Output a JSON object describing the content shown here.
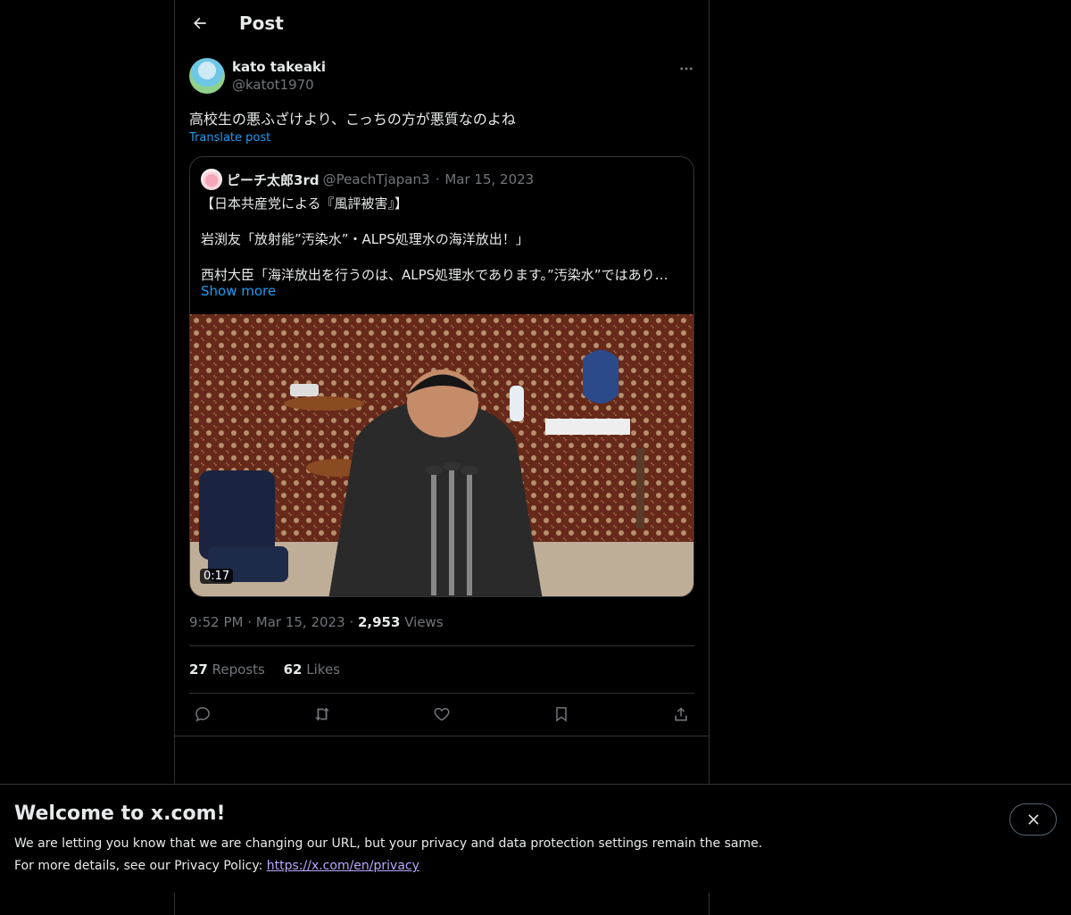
{
  "header": {
    "title": "Post"
  },
  "post": {
    "author_name": "kato takeaki",
    "author_handle": "@katot1970",
    "text": "高校生の悪ふざけより、こっちの方が悪質なのよね",
    "translate_label": "Translate post",
    "time": "9:52 PM",
    "date": "Mar 15, 2023",
    "views_count": "2,953",
    "views_label": "Views",
    "reposts_count": "27",
    "reposts_label": "Reposts",
    "likes_count": "62",
    "likes_label": "Likes"
  },
  "quote": {
    "author_name": "ピーチ太郎3rd",
    "author_handle": "@PeachTjapan3",
    "date": "Mar 15, 2023",
    "line1": "【日本共産党による『風評被害』】",
    "line2": "岩渕友「放射能”汚染水”・ALPS処理水の海洋放出！」",
    "line3": "西村大臣「海洋放出を行うのは、ALPS処理水であります。”汚染水”ではあり…",
    "show_more": "Show more",
    "video_duration": "0:17"
  },
  "icons": {
    "back": "arrow-left-icon",
    "more": "more-horizontal-icon",
    "reply": "reply-icon",
    "repost": "repost-icon",
    "like": "heart-icon",
    "bookmark": "bookmark-icon",
    "share": "share-icon",
    "close": "close-icon"
  },
  "banner": {
    "title": "Welcome to x.com!",
    "line1": "We are letting you know that we are changing our URL, but your privacy and data protection settings remain the same.",
    "line2_prefix": "For more details, see our Privacy Policy: ",
    "link": "https://x.com/en/privacy"
  },
  "colors": {
    "background": "#000000",
    "text": "#e7e9ea",
    "muted": "#71767b",
    "accent": "#1d9bf0",
    "border": "#2f3336",
    "link_visited": "#b9a7ff"
  }
}
